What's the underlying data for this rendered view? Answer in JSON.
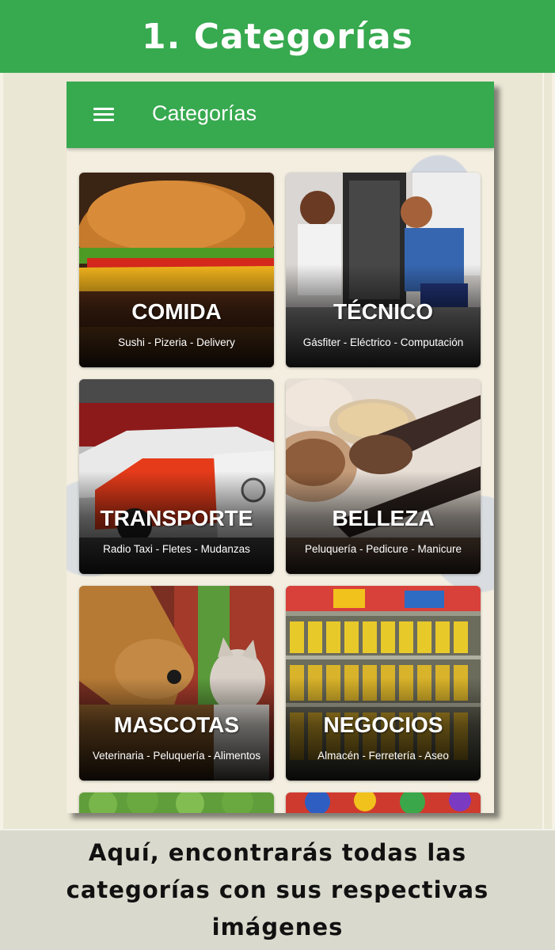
{
  "header": {
    "title": "1. Categorías"
  },
  "app": {
    "title": "Categorías",
    "menu_icon": "hamburger-menu-icon",
    "accent_color": "#37a94f"
  },
  "categories": [
    {
      "title": "COMIDA",
      "subtitle": "Sushi - Pizeria - Delivery"
    },
    {
      "title": "TÉCNICO",
      "subtitle": "Gásfiter - Eléctrico - Computación"
    },
    {
      "title": "TRANSPORTE",
      "subtitle": "Radio Taxi - Fletes - Mudanzas"
    },
    {
      "title": "BELLEZA",
      "subtitle": "Peluquería - Pedicure - Manicure"
    },
    {
      "title": "MASCOTAS",
      "subtitle": "Veterinaria - Peluquería - Alimentos"
    },
    {
      "title": "NEGOCIOS",
      "subtitle": "Almacén - Ferretería - Aseo"
    }
  ],
  "footer": {
    "caption": "Aquí, encontrarás todas las categorías con sus respectivas imágenes"
  }
}
